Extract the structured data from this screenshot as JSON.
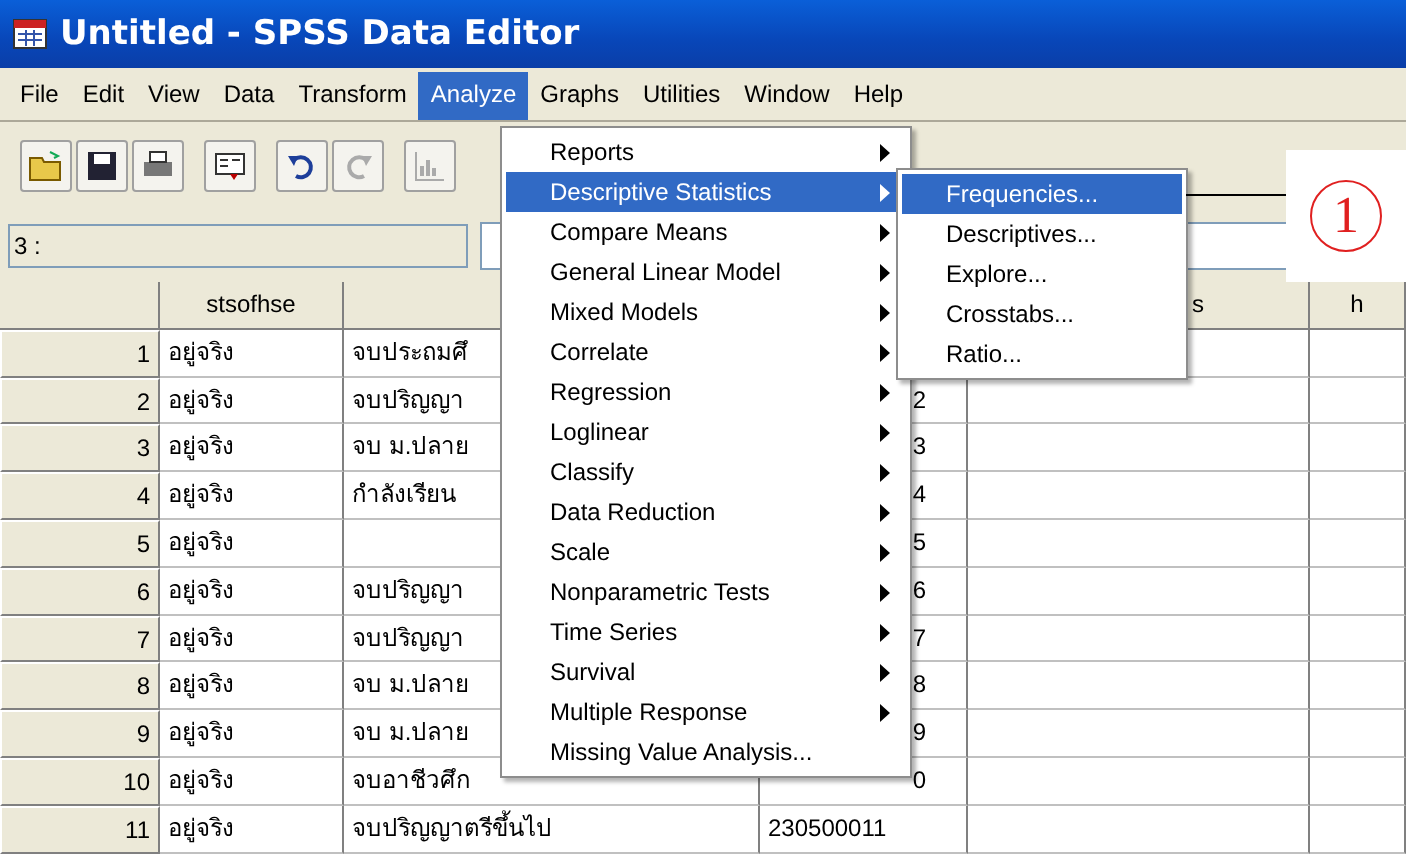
{
  "window": {
    "title": "Untitled - SPSS Data Editor"
  },
  "menubar": [
    {
      "label": "File",
      "selected": false
    },
    {
      "label": "Edit",
      "selected": false
    },
    {
      "label": "View",
      "selected": false
    },
    {
      "label": "Data",
      "selected": false
    },
    {
      "label": "Transform",
      "selected": false
    },
    {
      "label": "Analyze",
      "selected": true
    },
    {
      "label": "Graphs",
      "selected": false
    },
    {
      "label": "Utilities",
      "selected": false
    },
    {
      "label": "Window",
      "selected": false
    },
    {
      "label": "Help",
      "selected": false
    }
  ],
  "cell_editor": {
    "reference": "3 :"
  },
  "grid": {
    "columns": [
      "",
      "stsofhse",
      "",
      "",
      "s",
      "h"
    ],
    "rows": [
      {
        "number": "1",
        "column_1": "อยู่จริง",
        "column_2": "จบประถมศึ",
        "column_3": ""
      },
      {
        "number": "2",
        "column_1": "อยู่จริง",
        "column_2": "จบปริญญา",
        "column_3": "2"
      },
      {
        "number": "3",
        "column_1": "อยู่จริง",
        "column_2": "จบ ม.ปลาย",
        "column_3": "3"
      },
      {
        "number": "4",
        "column_1": "อยู่จริง",
        "column_2": "กำลังเรียน",
        "column_3": "4"
      },
      {
        "number": "5",
        "column_1": "อยู่จริง",
        "column_2": "",
        "column_3": "5"
      },
      {
        "number": "6",
        "column_1": "อยู่จริง",
        "column_2": "จบปริญญา",
        "column_3": "6"
      },
      {
        "number": "7",
        "column_1": "อยู่จริง",
        "column_2": "จบปริญญา",
        "column_3": "7"
      },
      {
        "number": "8",
        "column_1": "อยู่จริง",
        "column_2": "จบ ม.ปลาย",
        "column_3": "8"
      },
      {
        "number": "9",
        "column_1": "อยู่จริง",
        "column_2": "จบ ม.ปลาย",
        "column_3": "9"
      },
      {
        "number": "10",
        "column_1": "อยู่จริง",
        "column_2": "จบอาชีวศึก",
        "column_3": "0"
      },
      {
        "number": "11",
        "column_1": "อยู่จริง",
        "column_2": "จบปริญญาตรีขึ้นไป",
        "column_3": "230500011"
      }
    ]
  },
  "analyze_menu": [
    {
      "label": "Reports",
      "submenu": true,
      "selected": false
    },
    {
      "label": "Descriptive Statistics",
      "submenu": true,
      "selected": true
    },
    {
      "label": "Compare Means",
      "submenu": true,
      "selected": false
    },
    {
      "label": "General Linear Model",
      "submenu": true,
      "selected": false
    },
    {
      "label": "Mixed Models",
      "submenu": true,
      "selected": false
    },
    {
      "label": "Correlate",
      "submenu": true,
      "selected": false
    },
    {
      "label": "Regression",
      "submenu": true,
      "selected": false
    },
    {
      "label": "Loglinear",
      "submenu": true,
      "selected": false
    },
    {
      "label": "Classify",
      "submenu": true,
      "selected": false
    },
    {
      "label": "Data Reduction",
      "submenu": true,
      "selected": false
    },
    {
      "label": "Scale",
      "submenu": true,
      "selected": false
    },
    {
      "label": "Nonparametric Tests",
      "submenu": true,
      "selected": false
    },
    {
      "label": "Time Series",
      "submenu": true,
      "selected": false
    },
    {
      "label": "Survival",
      "submenu": true,
      "selected": false
    },
    {
      "label": "Multiple Response",
      "submenu": true,
      "selected": false
    },
    {
      "label": "Missing Value Analysis...",
      "submenu": false,
      "selected": false
    }
  ],
  "descriptive_submenu": [
    {
      "label": "Frequencies...",
      "selected": true
    },
    {
      "label": "Descriptives...",
      "selected": false
    },
    {
      "label": "Explore...",
      "selected": false
    },
    {
      "label": "Crosstabs...",
      "selected": false
    },
    {
      "label": "Ratio...",
      "selected": false
    }
  ],
  "callout": {
    "label": "1"
  }
}
